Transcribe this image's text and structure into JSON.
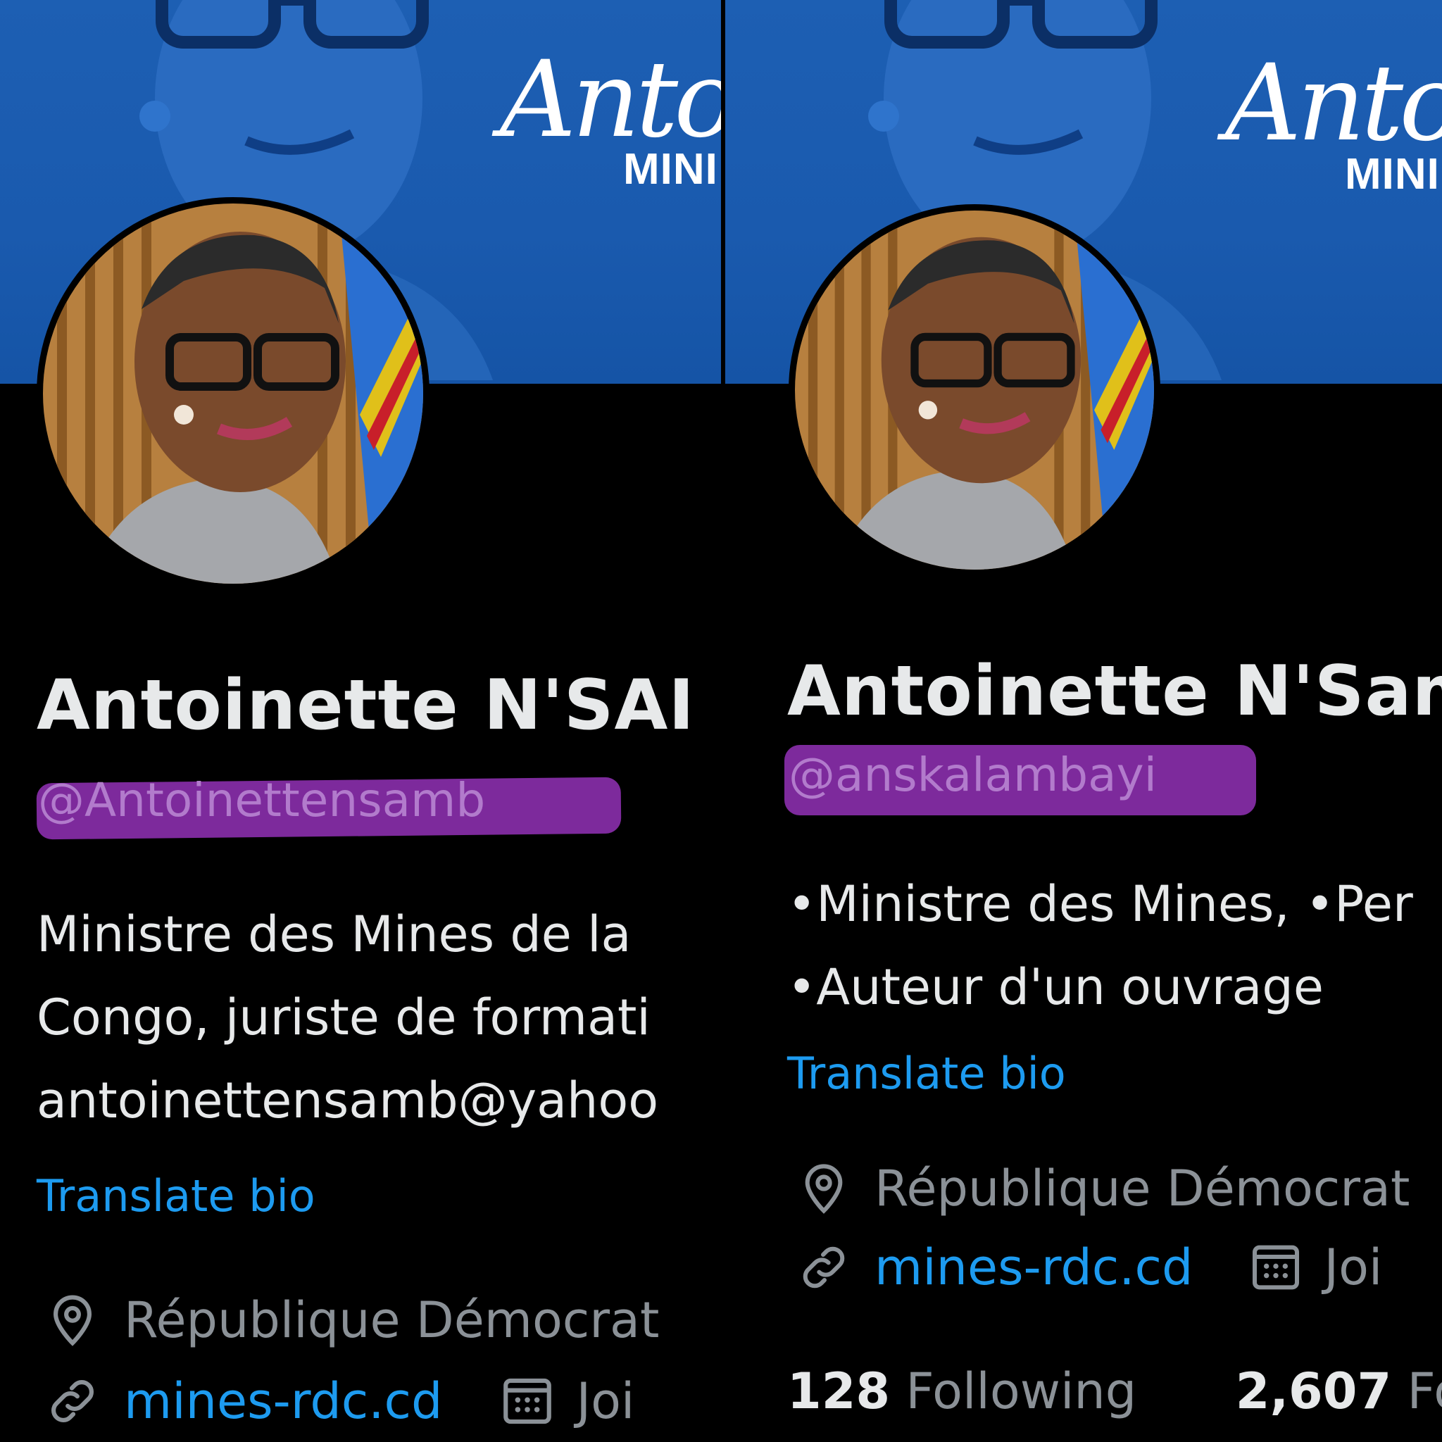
{
  "left": {
    "banner": {
      "script_text": "Antoi",
      "sub_text": "MINI"
    },
    "name": "Antoinette N'SAI",
    "handle": "@Antoinettensamb",
    "bio_lines": [
      "Ministre des Mines de la",
      "Congo, juriste de formati",
      "antoinettensamb@yahoo"
    ],
    "translate_label": "Translate bio",
    "location": "République Démocrat",
    "website": "mines-rdc.cd",
    "joined": "Joi"
  },
  "right": {
    "banner": {
      "script_text": "Antoi",
      "sub_text": "MINI"
    },
    "name": "Antoinette N'Sam",
    "handle": "@anskalambayi",
    "bio_lines": [
      "•Ministre des Mines, •Per",
      "•Auteur d'un ouvrage"
    ],
    "translate_label": "Translate bio",
    "location": "République Démocrat",
    "website": "mines-rdc.cd",
    "joined": "Joi",
    "following_count": "128",
    "following_label": "Following",
    "followers_count": "2,607",
    "followers_label": "Fo"
  },
  "icons": {
    "location": "location-pin-icon",
    "link": "link-icon",
    "calendar": "calendar-icon"
  },
  "colors": {
    "background": "#000000",
    "banner_blue": "#1a5aae",
    "link_blue": "#1d9bf0",
    "muted_text": "#8b9197",
    "highlight_purple": "#7d2a9c",
    "primary_text": "#e7e9ea"
  }
}
